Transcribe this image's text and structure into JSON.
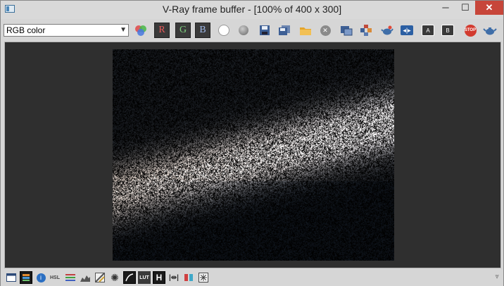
{
  "window": {
    "title": "V-Ray frame buffer - [100% of 400 x 300]",
    "minimize": "─",
    "maximize": "☐",
    "close": "✕"
  },
  "toolbar": {
    "channel_select": {
      "value": "RGB color"
    },
    "channel_r": "R",
    "channel_g": "G",
    "channel_b": "B",
    "stop_label": "STOP"
  },
  "statusbar": {
    "hsl_label": "HSL",
    "lut_label": "LUT",
    "h_label": "H"
  },
  "colors": {
    "title_close": "#c7463a",
    "frame_bg": "#2f2f2f",
    "channel_r": "#e85a5a",
    "channel_g": "#7fd27f",
    "channel_b": "#9fb8e8"
  }
}
